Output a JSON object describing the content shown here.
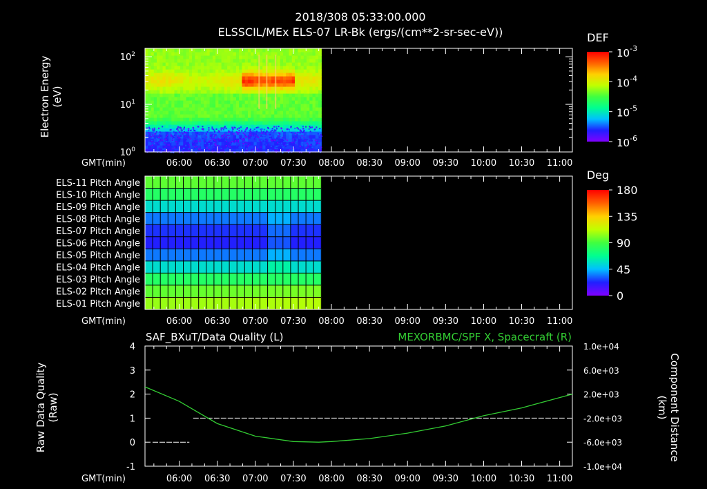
{
  "header": {
    "title": "2018/308 05:33:00.000",
    "subtitle": "ELSSCIL/MEx ELS-07 LR-Bk  (ergs/(cm**2-sr-sec-eV))"
  },
  "time_axis": {
    "label": "GMT(min)",
    "ticks": [
      "06:00",
      "06:30",
      "07:00",
      "07:30",
      "08:00",
      "08:30",
      "09:00",
      "09:30",
      "10:00",
      "10:30",
      "11:00"
    ]
  },
  "colors": {
    "background": "#000000",
    "axes": "#ffffff",
    "component_line": "#33cc33",
    "quality_line": "#ffffff",
    "colorbar_stops": [
      "#8000ff",
      "#2020ff",
      "#00c0ff",
      "#00ff90",
      "#40ff40",
      "#c0ff00",
      "#ffd000",
      "#ff6000",
      "#ff0000"
    ]
  },
  "chart_data": [
    {
      "type": "heatmap",
      "id": "energy-spectrogram",
      "ylabel": "Electron Energy\n(eV)",
      "y_scale": "log",
      "ylim": [
        1,
        150
      ],
      "y_ticks": [
        {
          "value": 1,
          "base": "10",
          "exp": "0"
        },
        {
          "value": 10,
          "base": "10",
          "exp": "1"
        },
        {
          "value": 100,
          "base": "10",
          "exp": "2"
        }
      ],
      "x_range": [
        "05:33",
        "11:10"
      ],
      "data_end": "07:52",
      "colorbar": {
        "label": "DEF",
        "scale": "log",
        "ticks": [
          {
            "base": "10",
            "exp": "-3"
          },
          {
            "base": "10",
            "exp": "-4"
          },
          {
            "base": "10",
            "exp": "-5"
          },
          {
            "base": "10",
            "exp": "-6"
          }
        ]
      }
    },
    {
      "type": "heatmap",
      "id": "pitch-angle",
      "rows": [
        "ELS-11 Pitch Angle",
        "ELS-10 Pitch Angle",
        "ELS-09 Pitch Angle",
        "ELS-08 Pitch Angle",
        "ELS-07 Pitch Angle",
        "ELS-06 Pitch Angle",
        "ELS-05 Pitch Angle",
        "ELS-04 Pitch Angle",
        "ELS-03 Pitch Angle",
        "ELS-02 Pitch Angle",
        "ELS-01 Pitch Angle"
      ],
      "row_values_deg": [
        95,
        80,
        55,
        35,
        25,
        22,
        35,
        55,
        80,
        95,
        105
      ],
      "x_range": [
        "05:33",
        "11:10"
      ],
      "data_end": "07:52",
      "colorbar": {
        "label": "Deg",
        "ticks": [
          "180",
          "135",
          "90",
          "45",
          "0"
        ],
        "range": [
          0,
          180
        ]
      }
    },
    {
      "type": "line",
      "id": "quality-component",
      "left_title": "SAF_BXuT/Data Quality (L)",
      "right_title": "MEXORBMC/SPF X, Spacecraft (R)",
      "ylabel_left": "Raw Data Quality\n(Raw)",
      "ylabel_right": "Component Distance\n(km)",
      "ylim_left": [
        -1,
        4
      ],
      "y_ticks_left": [
        "4",
        "3",
        "2",
        "1",
        "0",
        "-1"
      ],
      "ylim_right": [
        -10000,
        10000
      ],
      "y_ticks_right": [
        "1.0e+04",
        "6.0e+03",
        "2.0e+03",
        "-2.0e+03",
        "-6.0e+03",
        "-1.0e+04"
      ],
      "series": [
        {
          "name": "SAF_BXuT/Data Quality",
          "axis": "left",
          "segments": [
            {
              "x": [
                "05:39",
                "06:08"
              ],
              "y": [
                0,
                0
              ]
            },
            {
              "x": [
                "06:11",
                "11:05"
              ],
              "y": [
                1,
                1
              ]
            }
          ]
        },
        {
          "name": "MEXORBMC/SPF X, Spacecraft",
          "axis": "right",
          "x": [
            "05:33",
            "06:00",
            "06:30",
            "07:00",
            "07:30",
            "07:50",
            "08:00",
            "08:30",
            "09:00",
            "09:30",
            "10:00",
            "10:30",
            "11:10"
          ],
          "y": [
            3200,
            800,
            -2900,
            -5000,
            -5900,
            -6000,
            -5900,
            -5400,
            -4500,
            -3300,
            -1600,
            -300,
            2000
          ]
        }
      ]
    }
  ]
}
